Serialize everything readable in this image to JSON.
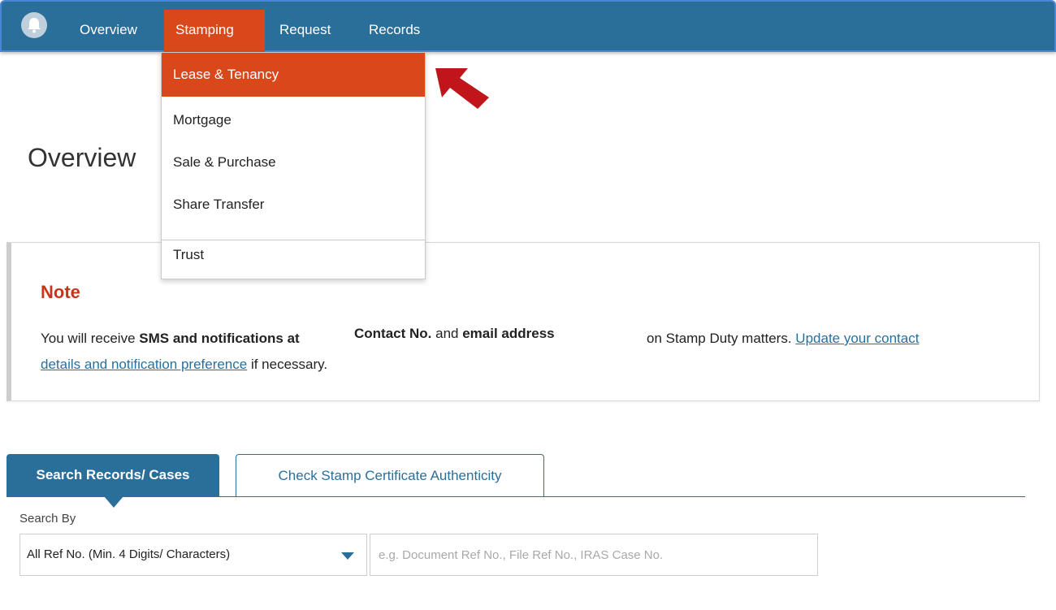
{
  "nav": {
    "items": [
      {
        "label": "Overview"
      },
      {
        "label": "Stamping"
      },
      {
        "label": "Request"
      },
      {
        "label": "Records"
      }
    ],
    "active_index": 1
  },
  "dropdown": {
    "items": [
      {
        "label": "Lease & Tenancy"
      },
      {
        "label": "Mortgage"
      },
      {
        "label": "Sale & Purchase"
      },
      {
        "label": "Share Transfer"
      },
      {
        "label": "Trust"
      }
    ],
    "active_index": 0
  },
  "page": {
    "title": "Overview"
  },
  "note": {
    "title": "Note",
    "text_prefix": "You will receive ",
    "bold_sms": "SMS and notifications at",
    "bold_contact": "Contact No.",
    "and_word": " and ",
    "bold_email": "email address",
    "text_after": "on Stamp Duty matters. ",
    "link_part1": "Update your contact",
    "link_part2": "details and notification preference",
    "text_suffix": " if necessary."
  },
  "tabs": [
    {
      "label": "Search Records/ Cases",
      "active": true
    },
    {
      "label": "Check Stamp Certificate Authenticity",
      "active": false
    }
  ],
  "search": {
    "label": "Search By",
    "selected_option": "All Ref No. (Min. 4 Digits/ Characters)",
    "input_value": "",
    "placeholder": "e.g. Document Ref No., File Ref No., IRAS Case No."
  },
  "colors": {
    "nav_bg": "#2a6f9a",
    "accent_orange": "#d9481b",
    "note_title_red": "#c8331b",
    "arrow_red": "#c0161b"
  },
  "icons": {
    "bell": "bell-icon",
    "arrow": "pointer-arrow-icon",
    "caret": "caret-down-icon"
  }
}
